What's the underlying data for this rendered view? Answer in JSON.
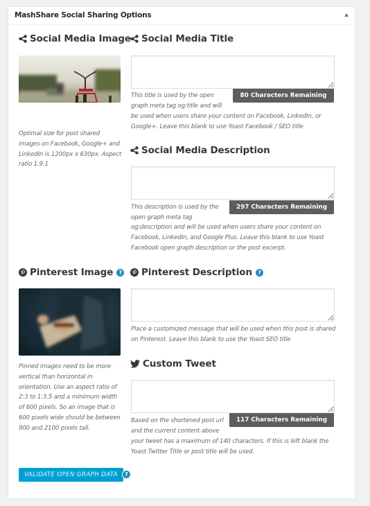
{
  "panel": {
    "title": "MashShare Social Sharing Options"
  },
  "social_image": {
    "heading": "Social Media Image",
    "icon": "share-icon",
    "note": "Optimal size for post shared images on Facebook, Google+ and LinkedIn is 1200px x 630px. Aspect ratio 1.9:1"
  },
  "social_title": {
    "heading": "Social Media Title",
    "icon": "share-icon",
    "value": "",
    "counter": "80 Characters Remaining",
    "note_top": "This title is used by the open graph meta tag og:title and will",
    "note_bottom": "be used when users share your content on Facebook, LinkedIn, or Google+. Leave this blank to use Yoast Facebook / SEO title"
  },
  "social_description": {
    "heading": "Social Media Description",
    "icon": "share-icon",
    "value": "",
    "counter": "297 Characters Remaining",
    "note_top": "This description is used by the open graph meta tag",
    "note_bottom": "og:description and will be used when users share your content on Facebook, LinkedIn, and Google Plus. Leave this blank to use Yoast Facebook open graph description or the post excerpt."
  },
  "pinterest_image": {
    "heading": "Pinterest Image",
    "icon": "pinterest-icon",
    "help": "?",
    "note": "Pinned images need to be more vertical than horizontal in orientation. Use an aspect ratio of 2:3 to 1:3.5 and a minimum width of 600 pixels. So an image that is 600 pixels wide should be between 900 and 2100 pixels tall."
  },
  "pinterest_description": {
    "heading": "Pinterest Description",
    "icon": "pinterest-icon",
    "help": "?",
    "value": "",
    "note": "Place a customized message that will be used when this post is shared on Pinterest. Leave this blank to use the Yoast SEO title"
  },
  "custom_tweet": {
    "heading": "Custom Tweet",
    "icon": "twitter-icon",
    "value": "",
    "counter": "117 Characters Remaining",
    "note_top": "Based on the shortened post url and the current content above",
    "note_bottom": "your tweet has a maximum of 140 characters. If this is left blank the Yoast Twitter Title or post title will be used."
  },
  "validate": {
    "label": "VALIDATE OPEN GRAPH DATA",
    "help": "?"
  },
  "colors": {
    "accent": "#00a0d2",
    "help_blue": "#1e8cbe",
    "counter_bg": "#5d5d5d"
  }
}
